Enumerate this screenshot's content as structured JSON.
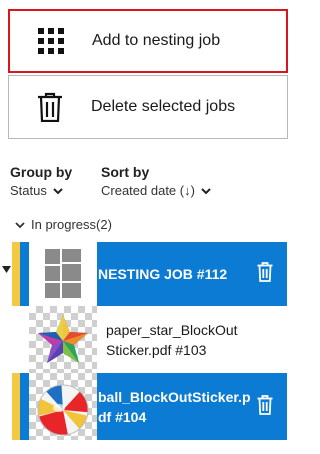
{
  "actions": {
    "add_label": "Add to nesting job",
    "delete_label": "Delete selected jobs"
  },
  "group_by": {
    "label": "Group by",
    "value": "Status"
  },
  "sort_by": {
    "label": "Sort by",
    "value": "Created date (↓)"
  },
  "section": {
    "title": "In progress(2)"
  },
  "jobs": [
    {
      "title": "NESTING JOB #112",
      "state": "selected",
      "thumbnail": "nesting-grid-icon"
    },
    {
      "title": "paper_star_BlockOutSticker.pdf #103",
      "line1": "paper_star_BlockOut",
      "line2": "Sticker.pdf #103",
      "state": "normal",
      "thumbnail": "star-thumbnail"
    },
    {
      "title": "ball_BlockOutSticker.pdf #104",
      "line1": "ball_BlockOutSticker.p",
      "line2": "df #104",
      "state": "selected",
      "thumbnail": "beach-ball-thumbnail"
    }
  ],
  "colors": {
    "accent_blue": "#0b7bd4",
    "stripe_yellow": "#f5c842",
    "focus_red": "#d9161c"
  }
}
